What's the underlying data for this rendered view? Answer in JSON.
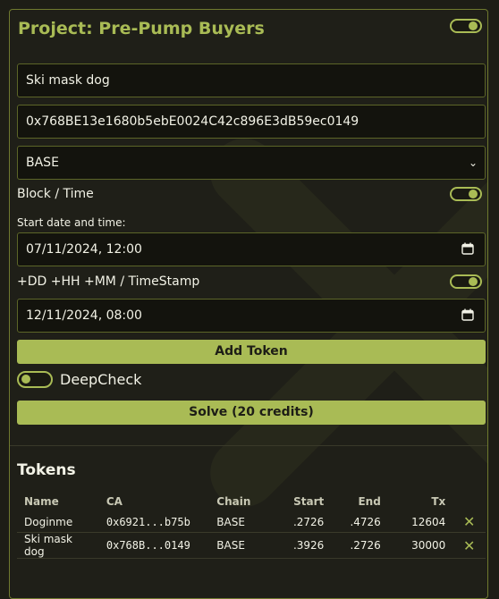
{
  "project": {
    "title": "Project: Pre-Pump Buyers",
    "toggle_on": true
  },
  "form": {
    "token_name": "Ski mask dog",
    "contract_address": "0x768BE13e1680b5ebE0024C42c896E3dB59ec0149",
    "chain": "BASE",
    "block_time_label": "Block / Time",
    "start_label": "Start date and time:",
    "start_value": "07/11/2024, 12:00",
    "offset_label": "+DD +HH +MM / TimeStamp",
    "end_value": "12/11/2024, 08:00",
    "add_token_label": "Add Token",
    "deepcheck_label": "DeepCheck",
    "solve_label": "Solve (20 credits)"
  },
  "tokens": {
    "title": "Tokens",
    "headers": [
      "Name",
      "CA",
      "Chain",
      "Start",
      "End",
      "Tx"
    ],
    "rows": [
      {
        "name": "Doginme",
        "ca": "0x6921...b75b",
        "chain": "BASE",
        "start": ".2726",
        "end": ".4726",
        "tx": "12604"
      },
      {
        "name": "Ski mask dog",
        "ca": "0x768B...0149",
        "chain": "BASE",
        "start": ".3926",
        "end": ".2726",
        "tx": "30000"
      }
    ]
  },
  "colors": {
    "accent": "#a9bb55",
    "background": "#1d1d16",
    "field": "#13130d"
  }
}
